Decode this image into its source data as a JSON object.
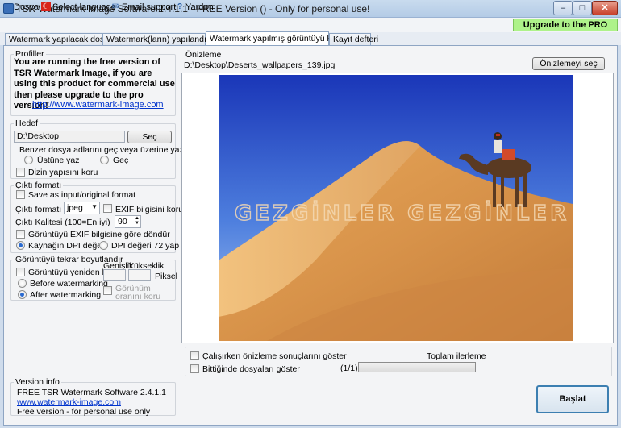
{
  "window": {
    "title": "TSR Watermark Image Software 2.4.1.1 - FREE Version () - Only for personal use!",
    "buttons": {
      "minimize": "–",
      "maximize": "□",
      "close": "✕"
    }
  },
  "menu": {
    "items": [
      {
        "label": "Dosya"
      },
      {
        "label": "Select language"
      },
      {
        "label": "Email support"
      },
      {
        "label": "Yardım"
      }
    ],
    "upgrade_label": "Upgrade to the PRO version"
  },
  "tabs": [
    {
      "label": "Watermark yapılacak dosyalar"
    },
    {
      "label": "Watermark(ların) yapılandırması"
    },
    {
      "label": "Watermark yapılmış görüntüyü kaydet"
    },
    {
      "label": "Kayıt defteri"
    }
  ],
  "profiles": {
    "label": "Profiller",
    "notice": "You are running the free version of TSR Watermark Image, if you are using this product for commercial use then please upgrade to the pro version!",
    "link": "http://www.watermark-image.com"
  },
  "target": {
    "label": "Hedef",
    "path": "D:\\Desktop",
    "select_button": "Seç",
    "question": "Benzer dosya adlarını geç veya üzerine yaz?",
    "overwrite_label": "Üstüne yaz",
    "skip_label": "Geç",
    "keep_structure_label": "Dizin yapısını koru"
  },
  "output_format": {
    "label": "Çıktı formatı",
    "save_as_input_label": "Save as input/original format",
    "format_label": "Çıktı formatı",
    "format_value": "jpeg",
    "exif_keep_label": "EXIF bilgisini koru",
    "quality_label": "Çıktı Kalitesi (100=En iyi)",
    "quality_value": "90",
    "rotate_exif_label": "Görüntüyü EXIF bilgisine göre döndür",
    "dpi_source_label": "Kaynağın DPI değerini al",
    "dpi_72_label": "DPI değeri 72 yap"
  },
  "resize": {
    "label": "Görüntüyü tekrar boyutlandır",
    "resize_label": "Görüntüyü yeniden boyutla",
    "width_label": "Genişlik",
    "height_label": "Yükseklik",
    "unit_label": "Piksel",
    "before_label": "Before watermarking",
    "after_label": "After watermarking",
    "keep_ratio_label": "Görünüm oranını koru"
  },
  "version_info": {
    "label": "Version info",
    "line1": "FREE TSR Watermark Software 2.4.1.1",
    "link": "www.watermark-image.com",
    "line3": "Free version - for personal use only"
  },
  "preview": {
    "label": "Önizleme",
    "file_path": "D:\\Desktop\\Deserts_wallpapers_139.jpg",
    "select_button": "Önizlemeyi seç",
    "watermark_text": "GEZGİNLER GEZGİNLER"
  },
  "bottom": {
    "show_preview_label": "Çalışırken önizleme sonuçlarını göster",
    "show_files_label": "Bittiğinde dosyaları göster",
    "total_progress_label": "Toplam ilerleme",
    "progress_count": "(1/1)",
    "start_button": "Başlat"
  },
  "colors": {
    "upgrade_bg": "#aef28a",
    "link": "#0033cc",
    "accent_border": "#3c7fb1"
  }
}
